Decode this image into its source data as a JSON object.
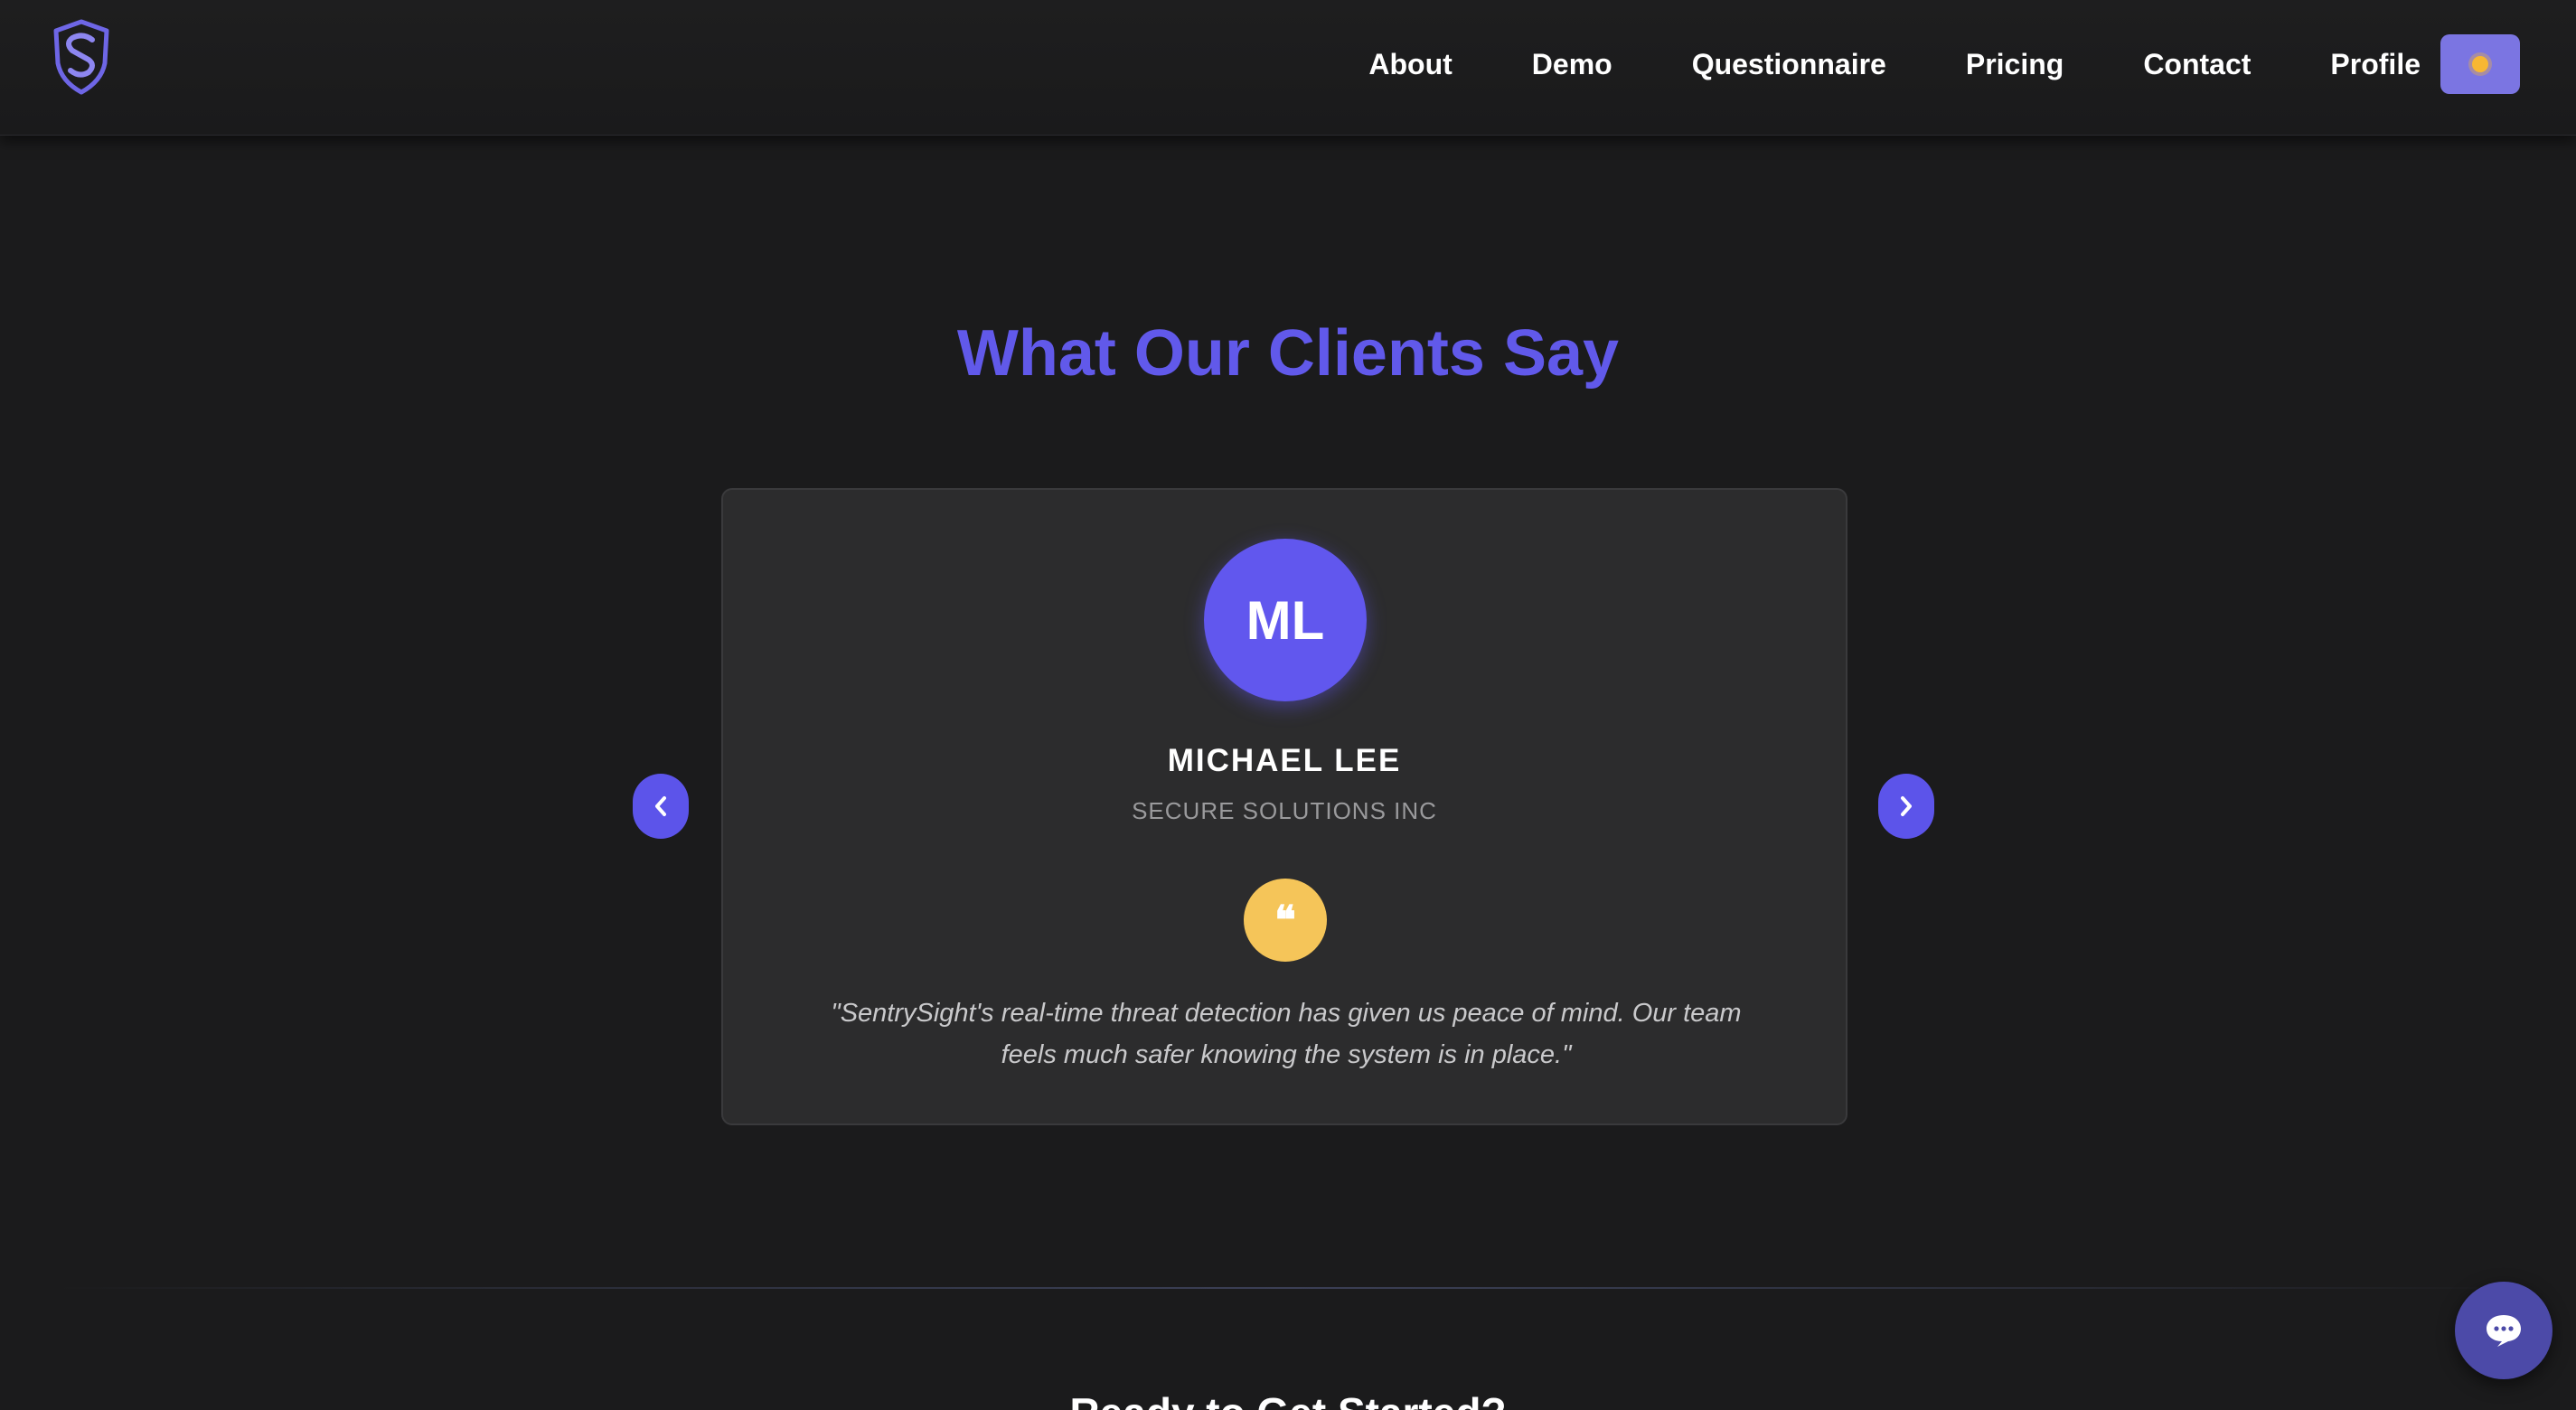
{
  "header": {
    "logo_icon": "shield-s-logo-icon",
    "nav": {
      "about": "About",
      "demo": "Demo",
      "questionnaire": "Questionnaire",
      "pricing": "Pricing",
      "contact": "Contact",
      "profile": "Profile"
    },
    "theme_toggle_icon": "sun-icon"
  },
  "testimonials": {
    "title": "What Our Clients Say",
    "current": {
      "initials": "ML",
      "name": "MICHAEL LEE",
      "company": "SECURE SOLUTIONS INC",
      "quote_icon": "quote-icon",
      "quote_mark": "❝",
      "quote": "\"SentrySight's real-time threat detection has given us peace of mind. Our team feels much safer knowing the system is in place.\""
    },
    "prev_icon": "chevron-left-icon",
    "next_icon": "chevron-right-icon"
  },
  "cta": {
    "heading": "Ready to Get Started?"
  },
  "chat": {
    "icon": "chat-bubble-icon"
  },
  "colors": {
    "background": "#1b1b1c",
    "accent": "#6159ea",
    "card": "#2c2c2d",
    "quote_badge": "#f5c559",
    "toggle": "#7b75e2"
  }
}
